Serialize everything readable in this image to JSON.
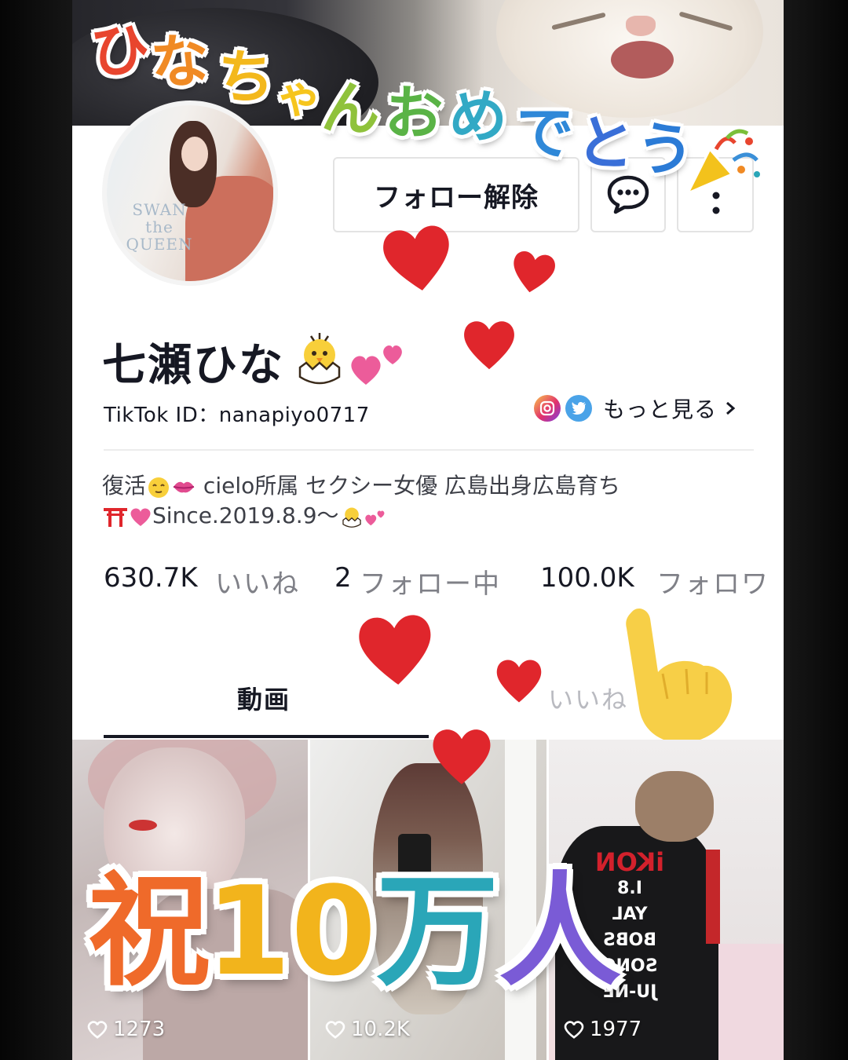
{
  "overlay": {
    "title_chars": [
      "ひ",
      "な",
      "ち",
      "ゃ",
      "ん",
      "お",
      "め",
      "で",
      "と",
      "う"
    ],
    "title_colors": [
      "#e8452e",
      "#f08a24",
      "#f3b81c",
      "#f6c51d",
      "#8fc23b",
      "#5ab346",
      "#32a9c5",
      "#2f88d8",
      "#3a6fd8",
      "#2b7bd6"
    ],
    "celebrate_chars": [
      "祝",
      "10",
      "万",
      "人"
    ],
    "celebrate_colors": [
      "#ef6a2a",
      "#f2b41c",
      "#2aa6b8",
      "#7a5bd6"
    ]
  },
  "profile": {
    "unfollow_label": "フォロー解除",
    "username": "七瀬ひな",
    "tiktok_id": "TikTok ID：nanapiyo0717",
    "see_more": "もっと見る",
    "bio_line1_a": "復活",
    "bio_line1_b": "cielo所属 セクシー女優 広島出身広島育ち",
    "bio_line2": "Since.2019.8.9〜",
    "avatar_text": "SWAN the QUEEN"
  },
  "stats": [
    {
      "value": "630.7K",
      "label": "いいね"
    },
    {
      "value": "2",
      "label": "フォロー中"
    },
    {
      "value": "100.0K",
      "label": "フォロワ"
    }
  ],
  "tabs": {
    "videos": "動画",
    "likes": "いいね"
  },
  "videos": [
    {
      "likes": "1273"
    },
    {
      "likes": "10.2K"
    },
    {
      "likes": "1977"
    }
  ],
  "video3_shirt": [
    "iKON",
    "I.8",
    "YAL",
    "BOBS",
    "SONG",
    "JU-NE"
  ],
  "colors": {
    "heart_red": "#e0262c",
    "heart_pink": "#ec5c9a",
    "text_dark": "#161823",
    "text_gray": "#7f8087",
    "hand_yellow": "#f7cf47"
  }
}
